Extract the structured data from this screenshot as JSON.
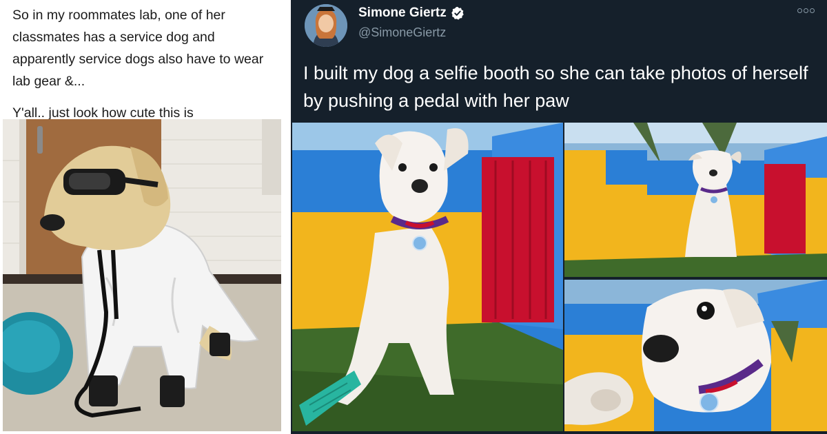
{
  "left_post": {
    "paragraph1": "So in my roommates lab, one of her classmates has a service dog and apparently service dogs also have to wear lab gear &...",
    "paragraph2": "Y'all.. just look how cute this is"
  },
  "tweet": {
    "display_name": "Simone Giertz",
    "handle": "@SimoneGiertz",
    "text": "I built my dog a selfie booth so she can take photos of herself by pushing a pedal with her paw",
    "more_icon": "ellipsis-icon",
    "verified_icon": "verified-badge-icon"
  },
  "colors": {
    "tweet_background": "#15202b",
    "name_text": "#ffffff",
    "handle_text": "#8899a6",
    "verified_blue": "#1da1f2",
    "booth_yellow": "#f2b51d",
    "booth_blue": "#2b7fd6",
    "curtain_red": "#c8102e",
    "turf_green": "#3f6b2a"
  }
}
